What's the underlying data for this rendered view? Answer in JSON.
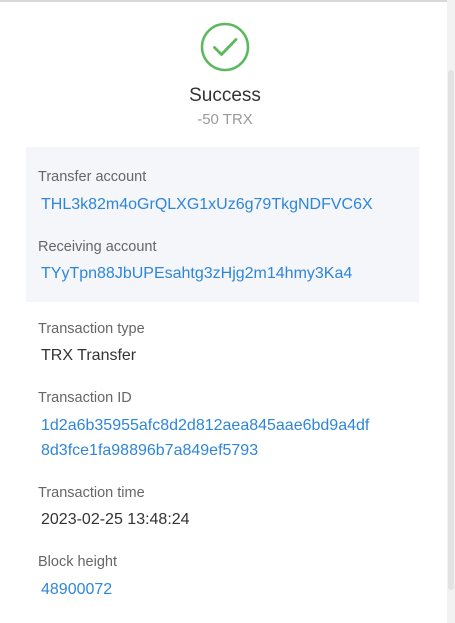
{
  "status": {
    "icon": "check-circle-icon",
    "title": "Success",
    "amount": "-50 TRX",
    "color": "#5cb85c"
  },
  "accounts": {
    "transfer_label": "Transfer account",
    "transfer_value": "THL3k82m4oGrQLXG1xUz6g79TkgNDFVC6X",
    "receiving_label": "Receiving account",
    "receiving_value": "TYyTpn88JbUPEsahtg3zHjg2m14hmy3Ka4"
  },
  "details": {
    "type_label": "Transaction type",
    "type_value": "TRX Transfer",
    "id_label": "Transaction ID",
    "id_value_line1": "1d2a6b35955afc8d2d812aea845aae6bd9a4df",
    "id_value_line2": "8d3fce1fa98896b7a849ef5793",
    "time_label": "Transaction time",
    "time_value": "2023-02-25 13:48:24",
    "height_label": "Block height",
    "height_value": "48900072"
  },
  "colors": {
    "link": "#2f86d8",
    "accounts_background": "#f4f6f9"
  }
}
